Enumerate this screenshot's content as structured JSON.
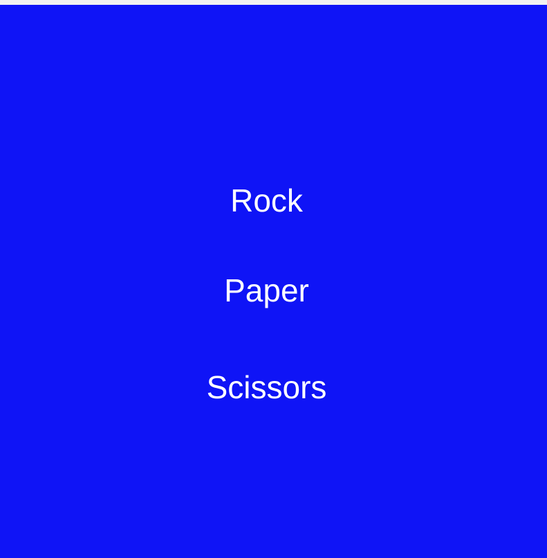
{
  "game": {
    "background_color": "#0f14f6",
    "text_color": "#ffffff",
    "choices": [
      {
        "id": "rock",
        "label": "Rock"
      },
      {
        "id": "paper",
        "label": "Paper"
      },
      {
        "id": "scissors",
        "label": "Scissors"
      }
    ]
  }
}
